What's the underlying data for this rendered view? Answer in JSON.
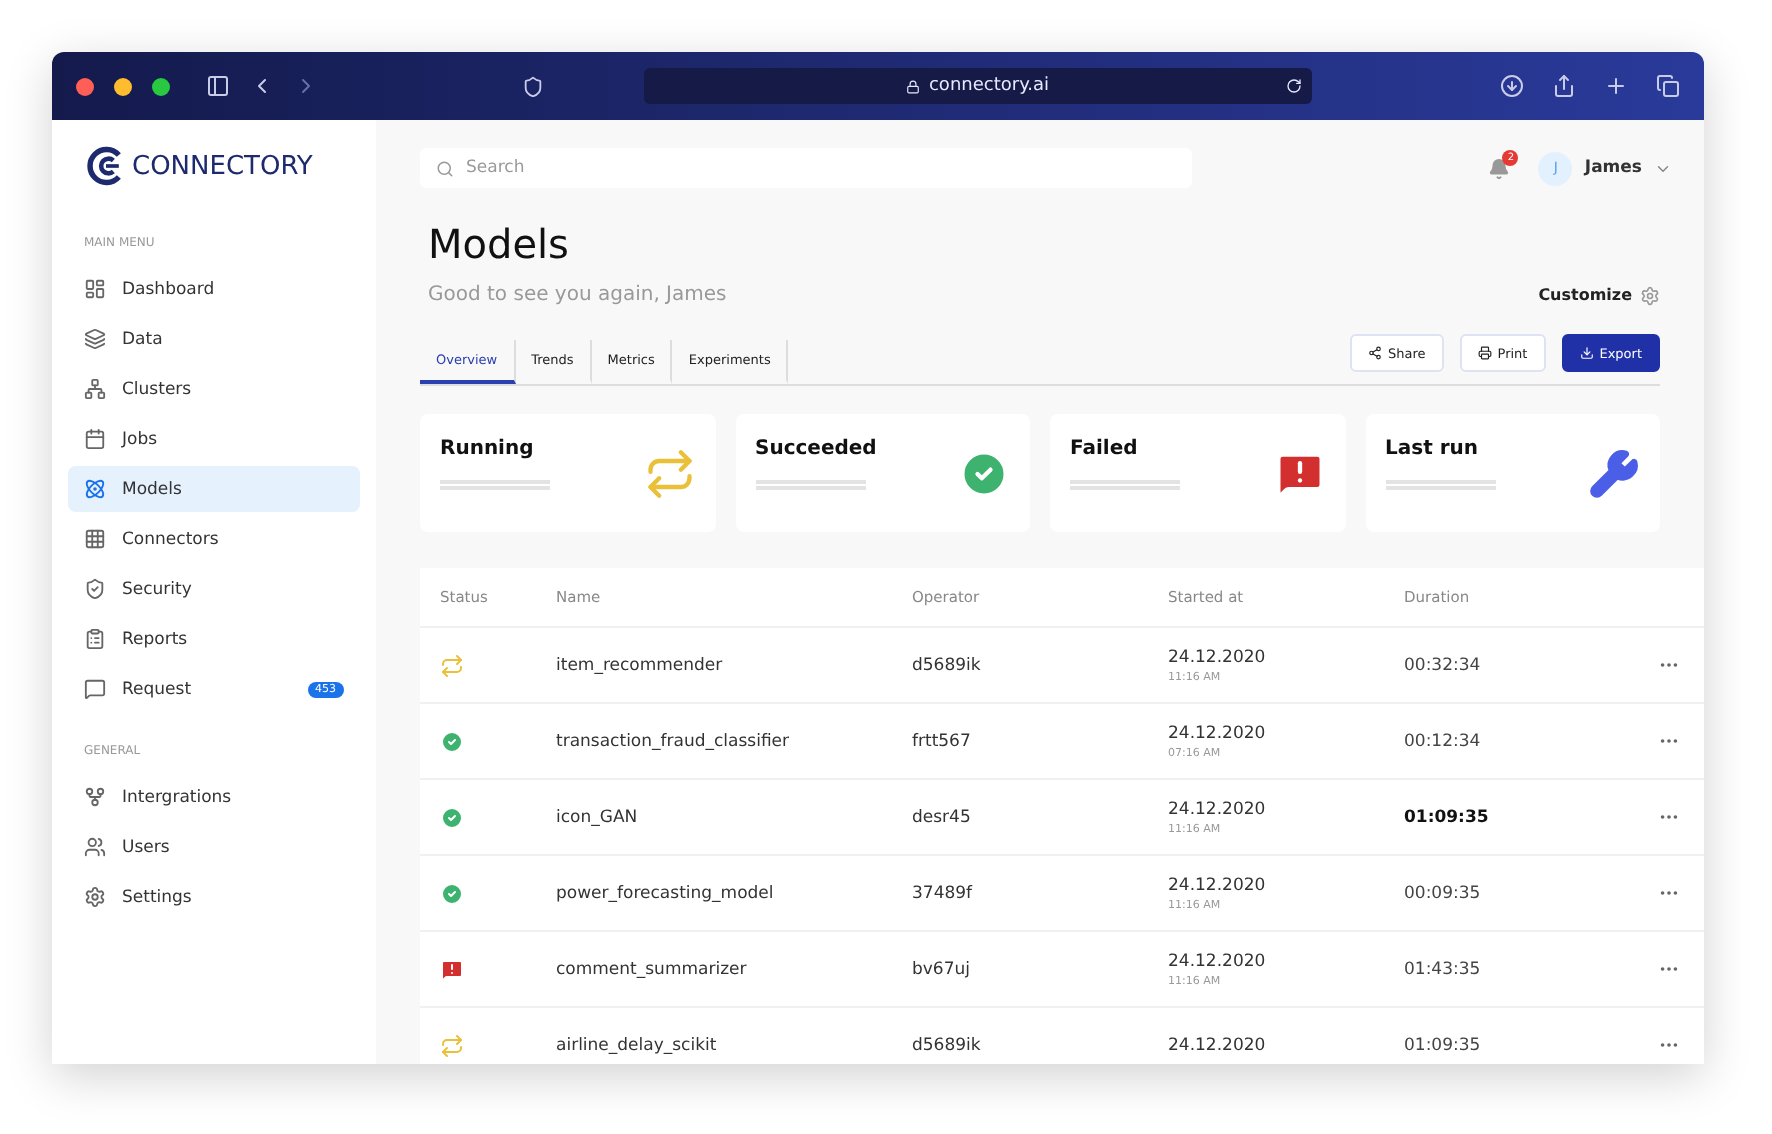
{
  "browser": {
    "url": "connectory.ai"
  },
  "sidebar": {
    "logo": "CONNECTORY",
    "sections": [
      {
        "heading": "MAIN MENU",
        "items": [
          {
            "label": "Dashboard",
            "selected": false
          },
          {
            "label": "Data",
            "selected": false
          },
          {
            "label": "Clusters",
            "selected": false
          },
          {
            "label": "Jobs",
            "selected": false
          },
          {
            "label": "Models",
            "selected": true
          },
          {
            "label": "Connectors",
            "selected": false
          },
          {
            "label": "Security",
            "selected": false
          },
          {
            "label": "Reports",
            "selected": false
          },
          {
            "label": "Request",
            "selected": false,
            "badge": "453"
          }
        ]
      },
      {
        "heading": "GENERAL",
        "items": [
          {
            "label": "Intergrations",
            "selected": false
          },
          {
            "label": "Users",
            "selected": false
          },
          {
            "label": "Settings",
            "selected": false
          }
        ]
      }
    ]
  },
  "topbar": {
    "search": {
      "placeholder": "Search"
    },
    "notifications": "2",
    "user": {
      "initial": "J",
      "name": "James"
    }
  },
  "page": {
    "title": "Models",
    "subtitle": "Good to see you again, James",
    "customize": "Customize"
  },
  "tabs": [
    {
      "label": "Overview",
      "selected": true
    },
    {
      "label": "Trends",
      "selected": false
    },
    {
      "label": "Metrics",
      "selected": false
    },
    {
      "label": "Experiments",
      "selected": false
    }
  ],
  "actions": [
    {
      "label": "Share",
      "kind": "share",
      "primary": false
    },
    {
      "label": "Print",
      "kind": "print",
      "primary": false
    },
    {
      "label": "Export",
      "kind": "export",
      "primary": true
    }
  ],
  "cards": [
    {
      "title": "Running",
      "kind": "running"
    },
    {
      "title": "Succeeded",
      "kind": "succeeded"
    },
    {
      "title": "Failed",
      "kind": "failed"
    },
    {
      "title": "Last run",
      "kind": "lastrun"
    }
  ],
  "table": {
    "columns": [
      "Status",
      "Name",
      "Operator",
      "Started at",
      "Duration"
    ],
    "rows": [
      {
        "kind": "running",
        "name": "item_recommender",
        "operator": "d5689ik",
        "date": "24.12.2020",
        "time": "11:16 AM",
        "duration": "00:32:34",
        "emphasized": false
      },
      {
        "kind": "succeeded",
        "name": "transaction_fraud_classifier",
        "operator": "frtt567",
        "date": "24.12.2020",
        "time": "07:16 AM",
        "duration": "00:12:34",
        "emphasized": false
      },
      {
        "kind": "succeeded",
        "name": "icon_GAN",
        "operator": "desr45",
        "date": "24.12.2020",
        "time": "11:16 AM",
        "duration": "01:09:35",
        "emphasized": true
      },
      {
        "kind": "succeeded",
        "name": "power_forecasting_model",
        "operator": "37489f",
        "date": "24.12.2020",
        "time": "11:16 AM",
        "duration": "00:09:35",
        "emphasized": false
      },
      {
        "kind": "failed",
        "name": "comment_summarizer",
        "operator": "bv67uj",
        "date": "24.12.2020",
        "time": "11:16 AM",
        "duration": "01:43:35",
        "emphasized": false
      },
      {
        "kind": "running",
        "name": "airline_delay_scikit",
        "operator": "d5689ik",
        "date": "24.12.2020",
        "duration": "01:09:35",
        "emphasized": false
      }
    ]
  }
}
